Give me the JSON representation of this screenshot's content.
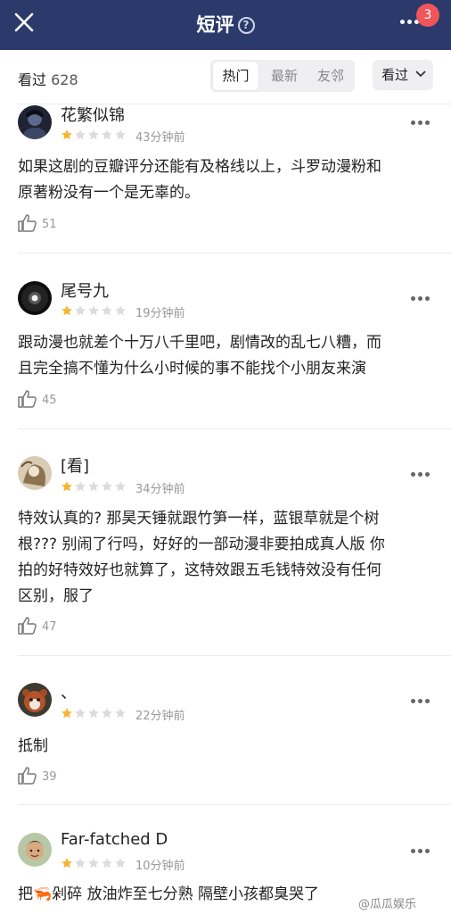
{
  "header": {
    "title": "短评",
    "help_icon": "question-circle-icon",
    "notification_count": "3"
  },
  "toolbar": {
    "count_label": "看过",
    "count_value": "628",
    "tabs": [
      {
        "label": "热门",
        "active": true
      },
      {
        "label": "最新",
        "active": false
      },
      {
        "label": "友邻",
        "active": false
      }
    ],
    "filter_label": "看过"
  },
  "colors": {
    "header_bg": "#2b3a6b",
    "star_filled": "#f5b531",
    "star_empty": "#dcdcdc",
    "badge": "#f0555a"
  },
  "reviews": [
    {
      "user": "花繁似锦",
      "rating": 1,
      "time": "43分钟前",
      "text": "如果这剧的豆瓣评分还能有及格线以上，斗罗动漫粉和\n原著粉没有一个是无辜的。",
      "likes": "51"
    },
    {
      "user": "尾号九",
      "rating": 1,
      "time": "19分钟前",
      "text": "跟动漫也就差个十万八千里吧，剧情改的乱七八糟，而\n且完全搞不懂为什么小时候的事不能找个小朋友来演",
      "likes": "45"
    },
    {
      "user": "[看]",
      "rating": 1,
      "time": "34分钟前",
      "text": "特效认真的? 那昊天锤就跟竹笋一样，蓝银草就是个树\n根??? 别闹了行吗，好好的一部动漫非要拍成真人版 你\n拍的好特效好也就算了，这特效跟五毛钱特效没有任何\n区别，服了",
      "likes": "47"
    },
    {
      "user": "、",
      "rating": 1,
      "time": "22分钟前",
      "text": "抵制",
      "likes": "39"
    },
    {
      "user": "Far-fatched D",
      "rating": 1,
      "time": "10分钟前",
      "text": "把🦐剁碎 放油炸至七分熟 隔壁小孩都臭哭了",
      "likes": ""
    }
  ],
  "watermark": "@瓜瓜娱乐"
}
